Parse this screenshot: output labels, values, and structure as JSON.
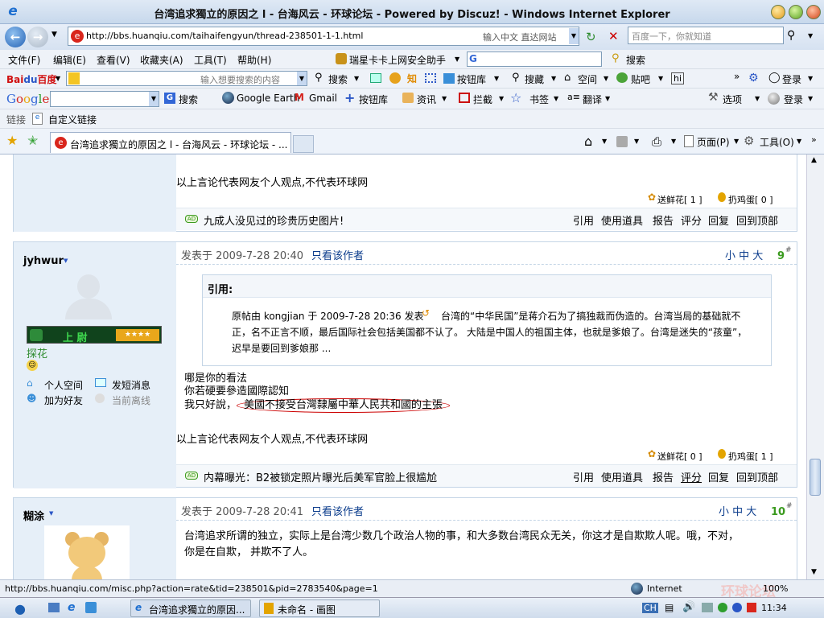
{
  "window": {
    "title": "台湾追求獨立的原因之 l - 台海风云 - 环球论坛 - Powered by Discuz! - Windows Internet Explorer"
  },
  "address": {
    "url": "http://bbs.huanqiu.com/taihaifengyun/thread-238501-1-1.html",
    "hint": "输入中文 直达网站",
    "search_placeholder": "百度一下，你就知道"
  },
  "menu": {
    "items": [
      "文件(F)",
      "编辑(E)",
      "查看(V)",
      "收藏夹(A)",
      "工具(T)",
      "帮助(H)"
    ],
    "assistant": "瑞星卡卡上网安全助手",
    "search": "搜索"
  },
  "baidu": {
    "field_value": "输入想要搜索的内容",
    "search": "搜索",
    "btn_lib": "按钮库",
    "souc": "搜藏",
    "space": "空间",
    "tieba": "贴吧",
    "login": "登录"
  },
  "google": {
    "search": "搜索",
    "earth": "Google Earth",
    "gmail": "Gmail",
    "btn_lib": "按钮库",
    "news": "资讯",
    "block": "拦截",
    "bookmark": "书签",
    "translate": "翻译",
    "options": "选项",
    "login": "登录"
  },
  "links": {
    "label": "链接",
    "custom": "自定义链接"
  },
  "tabs": {
    "active": "台湾追求獨立的原因之 l - 台海风云 - 环球论坛 - ...",
    "page": "页面(P)",
    "tools": "工具(O)"
  },
  "post1": {
    "disclaimer": "以上言论代表网友个人观点,不代表环球网",
    "flowers": "送鲜花[ 1 ]",
    "eggs": "扔鸡蛋[ 0 ]",
    "ad": "九成人没见过的珍贵历史图片!",
    "actions": [
      "引用",
      "使用道具",
      "报告",
      "评分",
      "回复",
      "回到顶部"
    ]
  },
  "post2": {
    "author": "jyhwur",
    "rank": "上 尉",
    "status_text": "探花",
    "posted": "发表于 2009-7-28 20:40",
    "only_author": "只看该作者",
    "font_sizes": "小 中 大",
    "floor": "9",
    "links": [
      "个人空间",
      "发短消息",
      "加为好友",
      "当前离线"
    ],
    "quote_title": "引用:",
    "quote_text": [
      "原帖由 kongjian 于 2009-7-28 20:36 发表",
      "台湾的“中华民国”是蒋介石为了搞独裁而伪造的。台湾当局的基础就不",
      "正，名不正言不顺，最后国际社会包括美国都不认了。  大陆是中国人的祖国主体，也就是爹娘了。台湾是迷失的“孩童”，",
      "迟早是要回到爹娘那 ..."
    ],
    "body": [
      "哪是你的看法",
      "你若硬要參造國際認知",
      "我只好說，",
      "美國不接受台灣隸屬中華人民共和國的主張"
    ],
    "disclaimer": "以上言论代表网友个人观点,不代表环球网",
    "flowers": "送鲜花[ 0 ]",
    "eggs": "扔鸡蛋[ 1 ]",
    "ad": "内幕曝光：B2被锁定照片曝光后美军官脸上很尴尬",
    "actions": [
      "引用",
      "使用道具",
      "报告",
      "评分",
      "回复",
      "回到顶部"
    ]
  },
  "post3": {
    "author": "糊涂",
    "posted": "发表于 2009-7-28 20:41",
    "only_author": "只看该作者",
    "font_sizes": "小 中 大",
    "floor": "10",
    "body": [
      "台湾追求所谓的独立，实际上是台湾少数几个政治人物的事，和大多数台湾民众无关，你这才是自欺欺人呢。哦，不对，",
      "你是在自欺，  并欺不了人。"
    ]
  },
  "statusbar": {
    "url": "http://bbs.huanqiu.com/misc.php?action=rate&tid=238501&pid=2783540&page=1",
    "zone": "Internet",
    "zoom": "100%",
    "watermark": "环球论坛"
  },
  "taskbar": {
    "items": [
      "台湾追求獨立的原因...",
      "未命名 - 画图"
    ],
    "lang": "CH",
    "time": "11:34"
  },
  "colors": {
    "link": "#0b3c8c",
    "sidebar_bg": "#e6eff8",
    "border": "#c4d5e6",
    "ad_green": "#3a9a1e"
  }
}
